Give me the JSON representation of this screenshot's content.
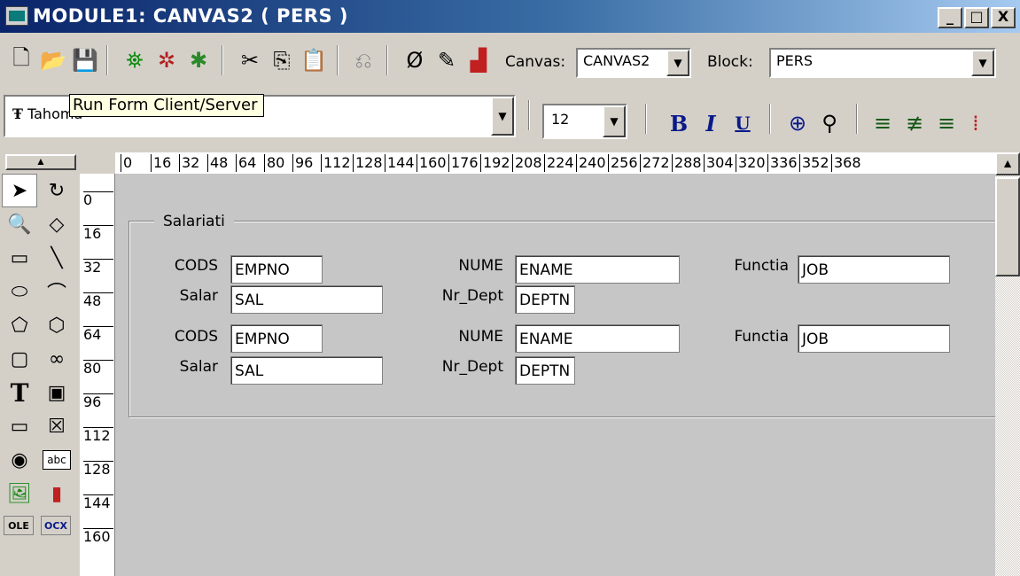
{
  "title": "MODULE1: CANVAS2 ( PERS )",
  "window_controls": {
    "minimize": "_",
    "maximize": "□",
    "close": "X"
  },
  "toolbar": {
    "canvas_label": "Canvas:",
    "canvas_value": "CANVAS2",
    "block_label": "Block:",
    "block_value": "PERS"
  },
  "font_toolbar": {
    "font_name": "Tahoma",
    "font_size": "12",
    "bold": "B",
    "italic": "I",
    "underline": "U"
  },
  "tooltip": "Run Form Client/Server",
  "hruler": [
    "0",
    "16",
    "32",
    "48",
    "64",
    "80",
    "96",
    "112",
    "128",
    "144",
    "160",
    "176",
    "192",
    "208",
    "224",
    "240",
    "256",
    "272",
    "288",
    "304",
    "320",
    "336",
    "352",
    "368"
  ],
  "vruler": [
    "0",
    "16",
    "32",
    "48",
    "64",
    "80",
    "96",
    "112",
    "128",
    "144",
    "160"
  ],
  "palette": {
    "text_tool": "T",
    "checkbox_tool": "☒",
    "textitem_tool": "abc",
    "ole_tool": "OLE",
    "ocx_tool": "OCX"
  },
  "form": {
    "frame_title": "Salariati",
    "rows": [
      {
        "cods_label": "CODS",
        "cods_value": "EMPNO",
        "nume_label": "NUME",
        "nume_value": "ENAME",
        "functia_label": "Functia",
        "functia_value": "JOB",
        "salar_label": "Salar",
        "salar_value": "SAL",
        "dept_label": "Nr_Dept",
        "dept_value": "DEPTN"
      },
      {
        "cods_label": "CODS",
        "cods_value": "EMPNO",
        "nume_label": "NUME",
        "nume_value": "ENAME",
        "functia_label": "Functia",
        "functia_value": "JOB",
        "salar_label": "Salar",
        "salar_value": "SAL",
        "dept_label": "Nr_Dept",
        "dept_value": "DEPTN"
      }
    ]
  }
}
